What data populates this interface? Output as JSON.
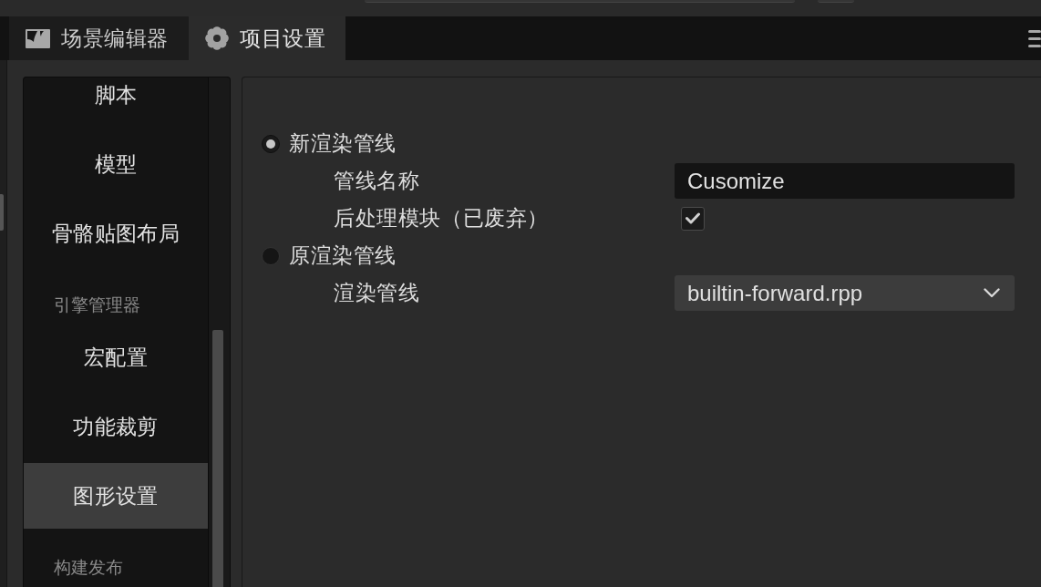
{
  "tabs": [
    {
      "label": "场景编辑器",
      "selected": false
    },
    {
      "label": "项目设置",
      "selected": true
    }
  ],
  "sidebar": {
    "items": [
      {
        "kind": "item",
        "label": "脚本",
        "selected": false
      },
      {
        "kind": "item",
        "label": "模型",
        "selected": false
      },
      {
        "kind": "item",
        "label": "骨骼贴图布局",
        "selected": false
      },
      {
        "kind": "group",
        "label": "引擎管理器"
      },
      {
        "kind": "item",
        "label": "宏配置",
        "selected": false
      },
      {
        "kind": "item",
        "label": "功能裁剪",
        "selected": false
      },
      {
        "kind": "item",
        "label": "图形设置",
        "selected": true
      },
      {
        "kind": "group",
        "label": "构建发布"
      }
    ]
  },
  "render_pipeline": {
    "options": [
      {
        "label": "新渲染管线",
        "selected": true,
        "fields": [
          {
            "kind": "text",
            "label": "管线名称",
            "value": "Cusomize"
          },
          {
            "kind": "checkbox",
            "label": "后处理模块（已废弃）",
            "checked": true
          }
        ]
      },
      {
        "label": "原渲染管线",
        "selected": false,
        "fields": [
          {
            "kind": "select",
            "label": "渲染管线",
            "value": "builtin-forward.rpp"
          }
        ]
      }
    ]
  }
}
